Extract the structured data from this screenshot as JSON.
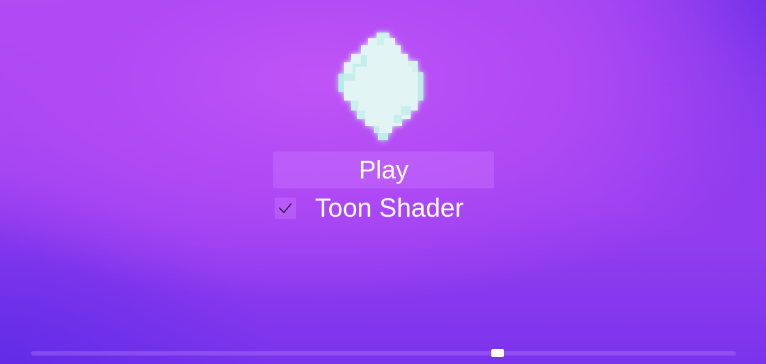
{
  "menu": {
    "logo_icon": "crystal-icon",
    "play_label": "Play",
    "toon_shader": {
      "label": "Toon Shader",
      "checked": true
    }
  },
  "scrollbar": {
    "position": 0.665
  },
  "colors": {
    "background_top": "#b24cf3",
    "background_bottom": "#7a34ec",
    "crystal": "#e2f5f4",
    "crystal_edge": "#bfeeea",
    "text": "#ffffff"
  }
}
